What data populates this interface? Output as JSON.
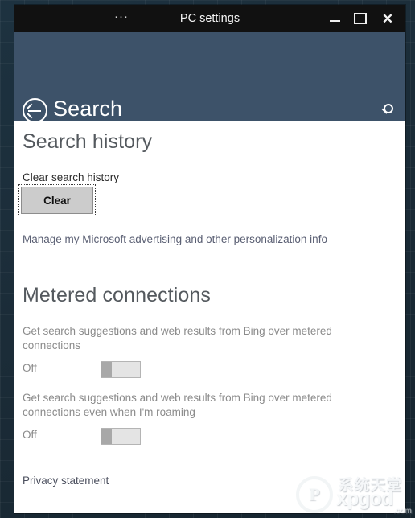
{
  "window": {
    "title": "PC settings",
    "menu_icon": "ellipsis-icon",
    "menu_label": "···",
    "controls": {
      "minimize_label": "",
      "maximize_label": "",
      "close_label": "✕"
    },
    "titlebar_bg": "#111111"
  },
  "header": {
    "back_label": "back-arrow-icon",
    "title": "Search",
    "search_icon": "search-icon",
    "bg": "#3d5269"
  },
  "sections": {
    "search_history": {
      "heading": "Search history",
      "clear_label": "Clear search history",
      "clear_button": "Clear",
      "advertising_link": "Manage my Microsoft advertising and other personalization info"
    },
    "metered_connections": {
      "heading": "Metered connections",
      "toggles": [
        {
          "description": "Get search suggestions and web results from Bing over metered connections",
          "state": "Off",
          "checked": false
        },
        {
          "description": "Get search suggestions and web results from Bing over metered connections even when I'm roaming",
          "state": "Off",
          "checked": false
        }
      ],
      "privacy_link": "Privacy statement"
    }
  },
  "watermark": {
    "logo_letter": "P",
    "chinese_text": "系统天堂",
    "domain": "xpgod",
    "tld": ".com"
  }
}
